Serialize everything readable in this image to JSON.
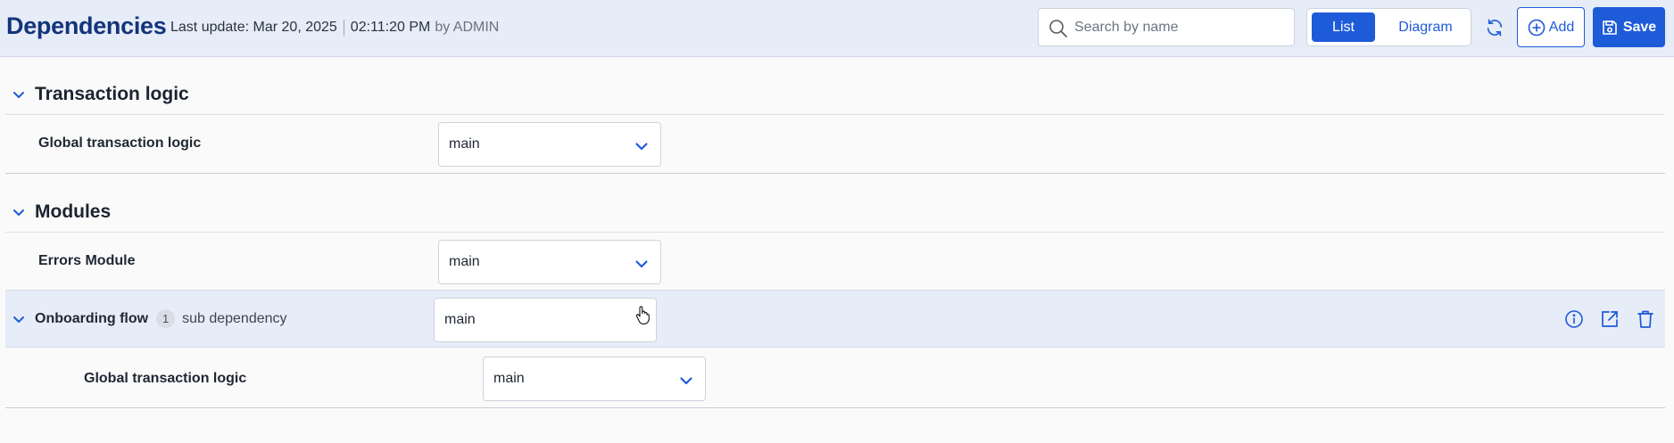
{
  "header": {
    "title": "Dependencies",
    "last_update_label": "Last update: Mar 20, 2025",
    "last_update_time": "02:11:20 PM",
    "last_update_by": "by ADMIN",
    "search_placeholder": "Search by name",
    "view_toggle": {
      "list": "List",
      "diagram": "Diagram",
      "active": "List"
    },
    "add_label": "Add",
    "save_label": "Save",
    "accent_color": "#1e5bd8"
  },
  "sections": [
    {
      "title": "Transaction logic",
      "rows": [
        {
          "label": "Global transaction logic",
          "value": "main"
        }
      ]
    },
    {
      "title": "Modules",
      "rows": [
        {
          "label": "Errors Module",
          "value": "main"
        },
        {
          "label": "Onboarding flow",
          "sub_count": "1",
          "sub_text": "sub dependency",
          "value": "main",
          "actions": [
            "info-icon",
            "open-external-icon",
            "trash-icon"
          ],
          "children": [
            {
              "label": "Global transaction logic",
              "value": "main"
            }
          ]
        }
      ]
    }
  ]
}
